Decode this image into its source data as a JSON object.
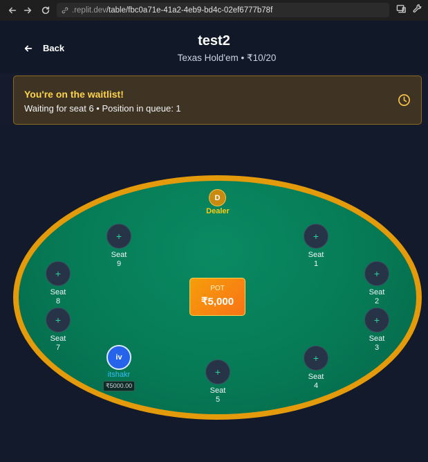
{
  "browser": {
    "url_host": ".replit.dev",
    "url_path": "/table/fbc0a71e-41a2-4eb9-bd4c-02ef6777b78f"
  },
  "header": {
    "back_label": "Back",
    "title": "test2",
    "subtitle": "Texas Hold'em • ₹10/20"
  },
  "waitlist": {
    "title": "You're on the waitlist!",
    "text": "Waiting for seat 6 • Position in queue: 1"
  },
  "table": {
    "dealer_chip": "D",
    "dealer_label": "Dealer",
    "pot_label": "POT",
    "pot_value": "₹5,000",
    "seats": [
      {
        "label": "Seat",
        "number": "1",
        "icon": "+"
      },
      {
        "label": "Seat",
        "number": "2",
        "icon": "+"
      },
      {
        "label": "Seat",
        "number": "3",
        "icon": "+"
      },
      {
        "label": "Seat",
        "number": "4",
        "icon": "+"
      },
      {
        "label": "Seat",
        "number": "5",
        "icon": "+"
      },
      {
        "label": "Seat",
        "number": "7",
        "icon": "+"
      },
      {
        "label": "Seat",
        "number": "8",
        "icon": "+"
      },
      {
        "label": "Seat",
        "number": "9",
        "icon": "+"
      }
    ],
    "player": {
      "initials": "iv",
      "name": "itshakr",
      "stack": "₹5000.00"
    }
  },
  "colors": {
    "felt": "#067a55",
    "rail": "#e39a0b",
    "pot": "#f59e0b",
    "waitlist_title": "#fcd34d",
    "player_avatar": "#2563eb"
  }
}
